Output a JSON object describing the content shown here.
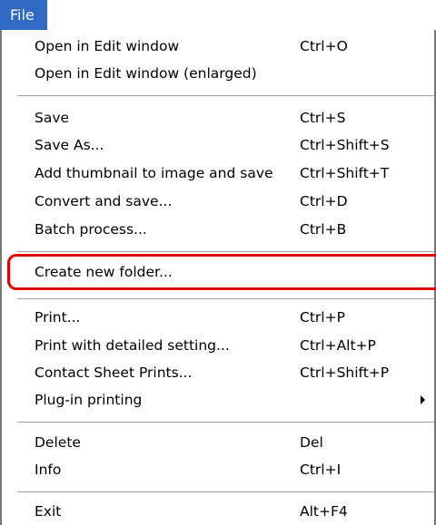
{
  "menu": {
    "title": "File",
    "items": [
      {
        "label": "Open in Edit window",
        "shortcut": "Ctrl+O"
      },
      {
        "label": "Open in Edit window (enlarged)",
        "shortcut": ""
      },
      {
        "label": "Save",
        "shortcut": "Ctrl+S"
      },
      {
        "label": "Save As...",
        "shortcut": "Ctrl+Shift+S"
      },
      {
        "label": "Add thumbnail to image and save",
        "shortcut": "Ctrl+Shift+T"
      },
      {
        "label": "Convert and save...",
        "shortcut": "Ctrl+D"
      },
      {
        "label": "Batch process...",
        "shortcut": "Ctrl+B"
      },
      {
        "label": "Create new folder...",
        "shortcut": ""
      },
      {
        "label": "Print...",
        "shortcut": "Ctrl+P"
      },
      {
        "label": "Print with detailed setting...",
        "shortcut": "Ctrl+Alt+P"
      },
      {
        "label": "Contact Sheet Prints...",
        "shortcut": "Ctrl+Shift+P"
      },
      {
        "label": "Plug-in printing",
        "shortcut": "",
        "submenu": true
      },
      {
        "label": "Delete",
        "shortcut": "Del"
      },
      {
        "label": "Info",
        "shortcut": "Ctrl+I"
      },
      {
        "label": "Exit",
        "shortcut": "Alt+F4"
      }
    ]
  },
  "colors": {
    "menu_title_background": "#316ac5",
    "highlight_outline": "#e00000"
  }
}
